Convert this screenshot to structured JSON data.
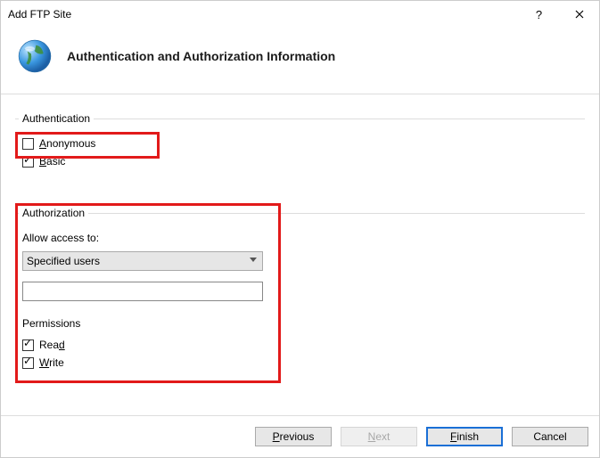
{
  "titlebar": {
    "title": "Add FTP Site"
  },
  "header": {
    "heading": "Authentication and Authorization Information"
  },
  "groups": {
    "authentication": {
      "legend": "Authentication",
      "anonymous": {
        "label_pre": "",
        "label_ul": "A",
        "label_post": "nonymous",
        "checked": false
      },
      "basic": {
        "label_pre": "",
        "label_ul": "B",
        "label_post": "asic",
        "checked": true
      }
    },
    "authorization": {
      "legend": "Authorization",
      "allow_label": "Allow access to:",
      "allow_value": "Specified users",
      "users_value": "",
      "permissions_label": "Permissions",
      "read": {
        "label_pre": "Rea",
        "label_ul": "d",
        "label_post": "",
        "checked": true
      },
      "write": {
        "label_pre": "",
        "label_ul": "W",
        "label_post": "rite",
        "checked": true
      }
    }
  },
  "buttons": {
    "previous": {
      "pre": "",
      "ul": "P",
      "post": "revious"
    },
    "next": {
      "pre": "",
      "ul": "N",
      "post": "ext"
    },
    "finish": {
      "pre": "",
      "ul": "F",
      "post": "inish"
    },
    "cancel": {
      "pre": "Cancel"
    }
  }
}
